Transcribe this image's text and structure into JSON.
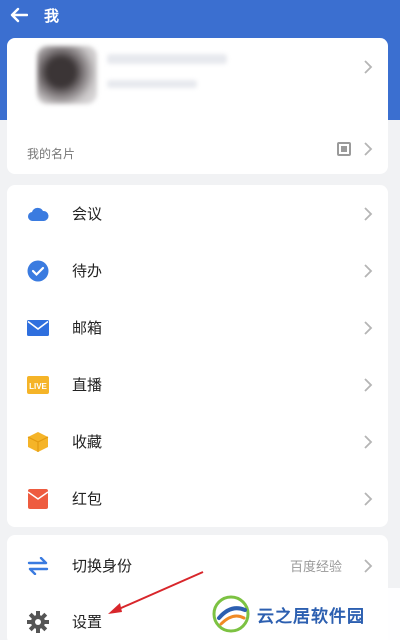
{
  "header": {
    "title": "我"
  },
  "profile": {
    "namecard_label": "我的名片"
  },
  "menu": {
    "items": [
      {
        "label": "会议",
        "icon": "cloud-icon",
        "color": "#3a7be0"
      },
      {
        "label": "待办",
        "icon": "check-circle-icon",
        "color": "#3a7be0"
      },
      {
        "label": "邮箱",
        "icon": "mail-icon",
        "color": "#2f6fde"
      },
      {
        "label": "直播",
        "icon": "live-icon",
        "color": "#f5b428"
      },
      {
        "label": "收藏",
        "icon": "box-icon",
        "color": "#f5b428"
      },
      {
        "label": "红包",
        "icon": "red-envelope-icon",
        "color": "#ee5b3f"
      }
    ]
  },
  "settings": {
    "switch_identity": {
      "label": "切换身份",
      "value": "百度经验"
    },
    "settings_label": "设置"
  },
  "watermark": {
    "text": "云之居软件园"
  }
}
